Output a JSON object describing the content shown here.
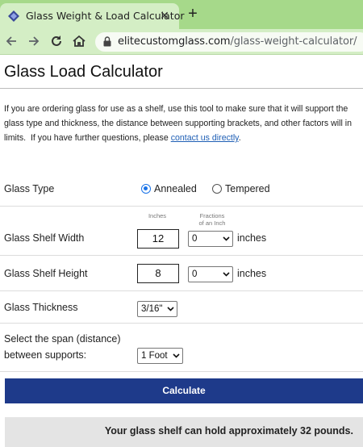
{
  "browser": {
    "tab_title": "Glass Weight & Load Calculator",
    "url_domain": "elitecustomglass.com",
    "url_path": "/glass-weight-calculator/",
    "icons": [
      "diamond-favicon-icon",
      "close-icon",
      "plus-icon",
      "back-arrow-icon",
      "forward-arrow-icon",
      "reload-icon",
      "home-icon",
      "lock-icon"
    ]
  },
  "page": {
    "title": "Glass Load Calculator",
    "intro": {
      "line1": "If you are ordering glass for use as a shelf, use this tool to make sure that it will support the",
      "line2": "glass type and thickness, the distance between supporting brackets, and other factors will in",
      "line3_before": "limits.  If you have further questions, please ",
      "link": "contact us directly",
      "line3_after": "."
    }
  },
  "form": {
    "glass_type": {
      "label": "Glass Type",
      "options": [
        {
          "label": "Annealed",
          "checked": true
        },
        {
          "label": "Tempered",
          "checked": false
        }
      ]
    },
    "column_headers": {
      "inches": "Inches",
      "fractions_line1": "Fractions",
      "fractions_line2": "of an Inch"
    },
    "width": {
      "label": "Glass Shelf Width",
      "inches": "12",
      "fraction": "0",
      "unit": "inches"
    },
    "height": {
      "label": "Glass Shelf Height",
      "inches": "8",
      "fraction": "0",
      "unit": "inches"
    },
    "thickness": {
      "label": "Glass Thickness",
      "value": "3/16\""
    },
    "span": {
      "label_line1": "Select the span (distance)",
      "label_line2": "between supports:",
      "value": "1 Foot"
    },
    "calculate_label": "Calculate",
    "result_text": "Your glass shelf can hold approximately 32 pounds."
  },
  "colors": {
    "tab_strip": "#a6d98a",
    "toolbar": "#d4eec5",
    "button": "#1e3a8a",
    "result_bg": "#e4e4e4",
    "radio_checked": "#1a73e8",
    "link": "#1f5fb5"
  }
}
